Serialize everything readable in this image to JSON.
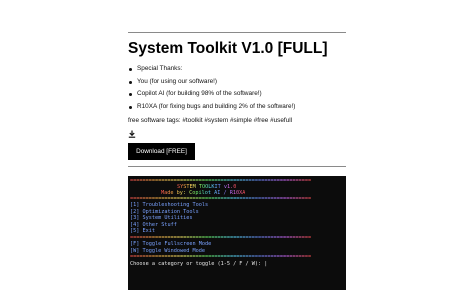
{
  "title": "System Toolkit V1.0 [FULL]",
  "thanks": [
    "Special Thanks:",
    "You (for using our software!)",
    "Copilot AI (for building 98% of the software!)",
    "R10XA (for fixing bugs and building 2% of the software!)"
  ],
  "tags_line": "free software tags: #toolkit #system #simple #free #usefull",
  "download_label": "Download [FREE]",
  "terminal": {
    "rule": "==========================================================",
    "title": "SYSTEM TOOLKIT v1.0",
    "subtitle": "Made by: Copilot AI / R10XA",
    "menu": [
      "[1] Troubleshooting Tools",
      "[2] Optimization Tools",
      "[3] System Utilities",
      "[4] Other Stuff",
      "[5] Exit"
    ],
    "toggles": [
      "[F] Toggle Fullscreen Mode",
      "[W] Toggle Windowed Mode"
    ],
    "prompt": "Choose a category or toggle (1-5 / F / W): |"
  },
  "colors": {
    "terminal_bg": "#0c0c0c",
    "button_bg": "#000000",
    "menu_text": "#7aa2ff"
  }
}
